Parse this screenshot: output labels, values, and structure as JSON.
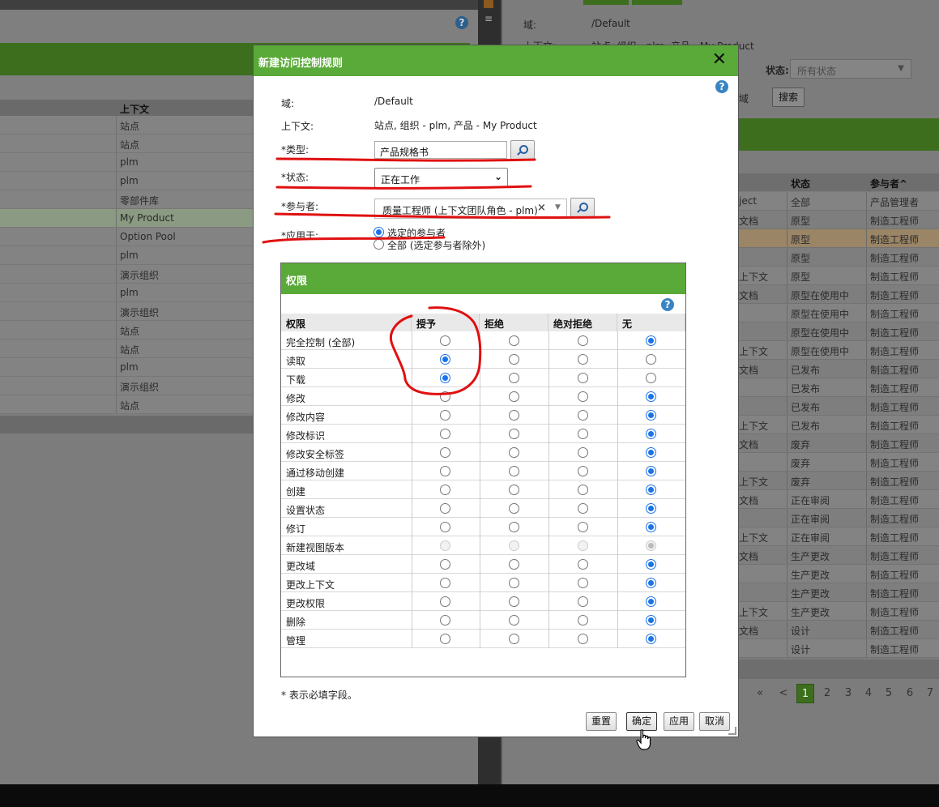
{
  "left_table": {
    "header": "上下文",
    "rows": [
      "站点",
      "站点",
      "plm",
      "plm",
      "零部件库",
      "My Product",
      "Option Pool",
      "plm",
      "演示组织",
      "plm",
      "演示组织",
      "站点",
      "站点",
      "plm",
      "演示组织",
      "站点"
    ],
    "highlight_row": 5
  },
  "right_panel": {
    "domain_label": "域:",
    "domain_value": "/Default",
    "context_label": "上下文:",
    "context_value": "站点, 组织 - plm, 产品 - My Product",
    "status_label": "状态:",
    "status_select": "所有状态",
    "area_text": "域",
    "search_button": "搜索",
    "table_headers": [
      "状态",
      "参与者^"
    ],
    "rows": [
      {
        "c1": "ject",
        "c2": "全部",
        "c3": "产品管理者"
      },
      {
        "c1": "文档",
        "c2": "原型",
        "c3": "制造工程师"
      },
      {
        "c1": "",
        "c2": "原型",
        "c3": "制造工程师"
      },
      {
        "c1": "",
        "c2": "原型",
        "c3": "制造工程师"
      },
      {
        "c1": "上下文",
        "c2": "原型",
        "c3": "制造工程师"
      },
      {
        "c1": "文档",
        "c2": "原型在使用中",
        "c3": "制造工程师"
      },
      {
        "c1": "",
        "c2": "原型在使用中",
        "c3": "制造工程师"
      },
      {
        "c1": "",
        "c2": "原型在使用中",
        "c3": "制造工程师"
      },
      {
        "c1": "上下文",
        "c2": "原型在使用中",
        "c3": "制造工程师"
      },
      {
        "c1": "文档",
        "c2": "已发布",
        "c3": "制造工程师"
      },
      {
        "c1": "",
        "c2": "已发布",
        "c3": "制造工程师"
      },
      {
        "c1": "",
        "c2": "已发布",
        "c3": "制造工程师"
      },
      {
        "c1": "上下文",
        "c2": "已发布",
        "c3": "制造工程师"
      },
      {
        "c1": "文档",
        "c2": "废弃",
        "c3": "制造工程师"
      },
      {
        "c1": "",
        "c2": "废弃",
        "c3": "制造工程师"
      },
      {
        "c1": "上下文",
        "c2": "废弃",
        "c3": "制造工程师"
      },
      {
        "c1": "文档",
        "c2": "正在审阅",
        "c3": "制造工程师"
      },
      {
        "c1": "",
        "c2": "正在审阅",
        "c3": "制造工程师"
      },
      {
        "c1": "上下文",
        "c2": "正在审阅",
        "c3": "制造工程师"
      },
      {
        "c1": "文档",
        "c2": "生产更改",
        "c3": "制造工程师"
      },
      {
        "c1": "",
        "c2": "生产更改",
        "c3": "制造工程师"
      },
      {
        "c1": "",
        "c2": "生产更改",
        "c3": "制造工程师"
      },
      {
        "c1": "上下文",
        "c2": "生产更改",
        "c3": "制造工程师"
      },
      {
        "c1": "文档",
        "c2": "设计",
        "c3": "制造工程师"
      },
      {
        "c1": "",
        "c2": "设计",
        "c3": "制造工程师"
      }
    ],
    "highlight_row": 2,
    "pager": [
      "«",
      "<",
      "1",
      "2",
      "3",
      "4",
      "5",
      "6",
      "7"
    ],
    "current_page": "1"
  },
  "dialog": {
    "title": "新建访问控制规则",
    "close_glyph": "✕",
    "help_glyph": "?",
    "domain_label": "域:",
    "domain_value": "/Default",
    "context_label": "上下文:",
    "context_value": "站点, 组织 - plm, 产品 - My Product",
    "type_label": "*类型:",
    "type_value": "产品规格书",
    "state_label": "*状态:",
    "state_value": "正在工作",
    "participant_label": "*参与者:",
    "participant_value": "质量工程师 (上下文团队角色 - plm)",
    "participant_clear": "×",
    "applyto_label": "*应用于:",
    "applyto_options": [
      {
        "label": "选定的参与者",
        "selected": true
      },
      {
        "label": "全部 (选定参与者除外)",
        "selected": false
      }
    ],
    "permissions": {
      "title": "权限",
      "columns": [
        "权限",
        "授予",
        "拒绝",
        "绝对拒绝",
        "无"
      ],
      "rows": [
        {
          "name": "完全控制 (全部)",
          "value": "none"
        },
        {
          "name": "读取",
          "value": "grant"
        },
        {
          "name": "下载",
          "value": "grant"
        },
        {
          "name": "修改",
          "value": "none"
        },
        {
          "name": "修改内容",
          "value": "none"
        },
        {
          "name": "修改标识",
          "value": "none"
        },
        {
          "name": "修改安全标签",
          "value": "none"
        },
        {
          "name": "通过移动创建",
          "value": "none"
        },
        {
          "name": "创建",
          "value": "none"
        },
        {
          "name": "设置状态",
          "value": "none"
        },
        {
          "name": "修订",
          "value": "none"
        },
        {
          "name": "新建视图版本",
          "value": "none",
          "disabled": true
        },
        {
          "name": "更改域",
          "value": "none"
        },
        {
          "name": "更改上下文",
          "value": "none"
        },
        {
          "name": "更改权限",
          "value": "none"
        },
        {
          "name": "删除",
          "value": "none"
        },
        {
          "name": "管理",
          "value": "none"
        }
      ]
    },
    "required_note": "* 表示必填字段。",
    "buttons": {
      "reset": "重置",
      "ok": "确定",
      "apply": "应用",
      "cancel": "取消"
    }
  },
  "colors": {
    "dialog_green": "#5aaa39",
    "dimmed_green": "#3c6e1d",
    "radio_blue": "#1a73e8",
    "annotation_red": "#e01010"
  }
}
